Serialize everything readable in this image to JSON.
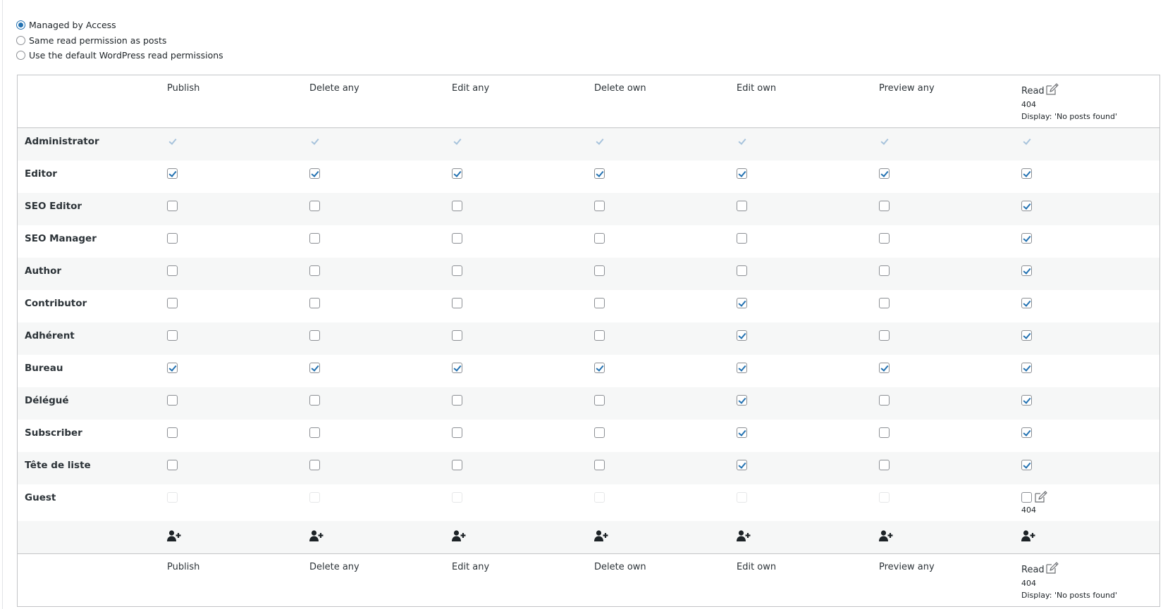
{
  "read_options": [
    {
      "label": "Managed by Access",
      "checked": true
    },
    {
      "label": "Same read permission as posts",
      "checked": false
    },
    {
      "label": "Use the default WordPress read permissions",
      "checked": false
    }
  ],
  "columns": [
    {
      "label": "Publish"
    },
    {
      "label": "Delete any"
    },
    {
      "label": "Edit any"
    },
    {
      "label": "Delete own"
    },
    {
      "label": "Edit own"
    },
    {
      "label": "Preview any"
    },
    {
      "label": "Read",
      "code": "404",
      "display": "Display: 'No posts found'",
      "icon": "edit-icon"
    }
  ],
  "rows": [
    {
      "role": "Administrator",
      "perms": [
        true,
        true,
        true,
        true,
        true,
        true,
        true
      ],
      "disabled": true
    },
    {
      "role": "Editor",
      "perms": [
        true,
        true,
        true,
        true,
        true,
        true,
        true
      ]
    },
    {
      "role": "SEO Editor",
      "perms": [
        false,
        false,
        false,
        false,
        false,
        false,
        true
      ]
    },
    {
      "role": "SEO Manager",
      "perms": [
        false,
        false,
        false,
        false,
        false,
        false,
        true
      ]
    },
    {
      "role": "Author",
      "perms": [
        false,
        false,
        false,
        false,
        false,
        false,
        true
      ]
    },
    {
      "role": "Contributor",
      "perms": [
        false,
        false,
        false,
        false,
        true,
        false,
        true
      ]
    },
    {
      "role": "Adhérent",
      "perms": [
        false,
        false,
        false,
        false,
        true,
        false,
        true
      ]
    },
    {
      "role": "Bureau",
      "perms": [
        true,
        true,
        true,
        true,
        true,
        true,
        true
      ]
    },
    {
      "role": "Délégué",
      "perms": [
        false,
        false,
        false,
        false,
        true,
        false,
        true
      ]
    },
    {
      "role": "Subscriber",
      "perms": [
        false,
        false,
        false,
        false,
        true,
        false,
        true
      ]
    },
    {
      "role": "Tête de liste",
      "perms": [
        false,
        false,
        false,
        false,
        true,
        false,
        true
      ]
    },
    {
      "role": "Guest",
      "perms": [
        false,
        false,
        false,
        false,
        false,
        false,
        false
      ],
      "guest": true,
      "guest_code": "404"
    }
  ],
  "add_user_icon": "add-user-icon",
  "colors": {
    "accent": "#2271b1",
    "border": "#c3c4c7",
    "alt_row": "#f6f7f7"
  }
}
